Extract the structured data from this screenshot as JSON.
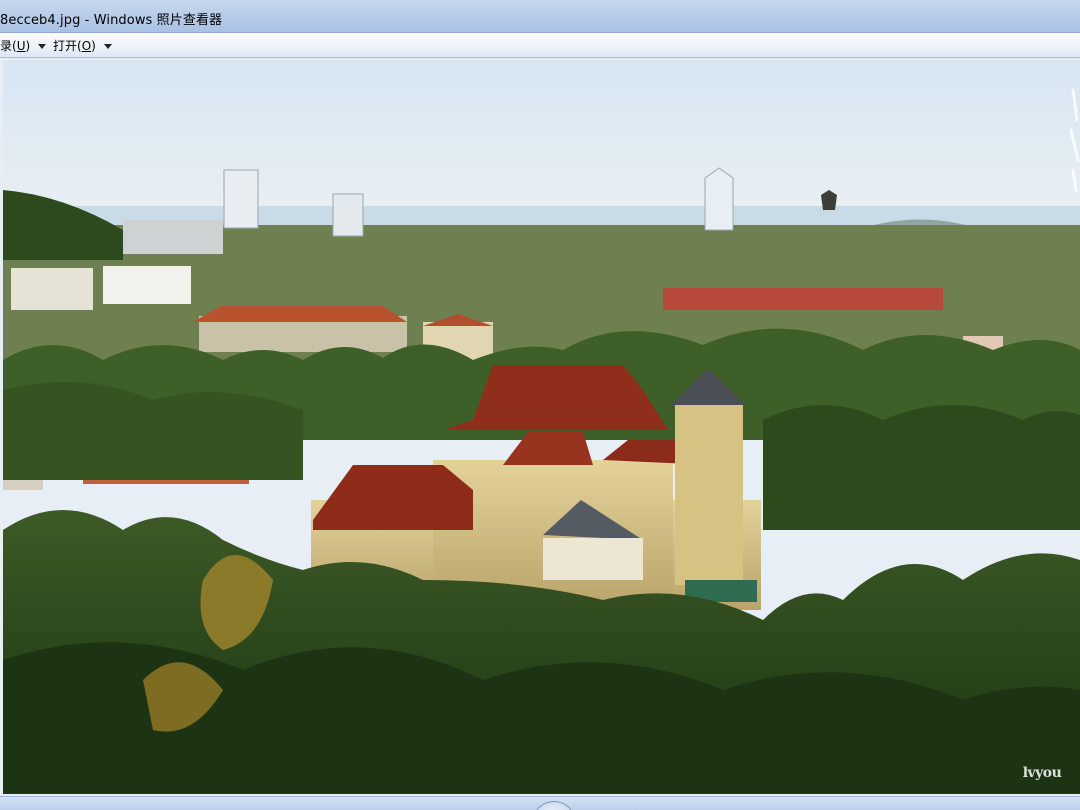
{
  "window": {
    "title": "8ecceb4.jpg - Windows 照片查看器"
  },
  "menu": {
    "items": [
      {
        "label": "录(U)",
        "pre": "录(",
        "acc": "U",
        "post": ")"
      },
      {
        "label": "打开(O)",
        "pre": "打开(",
        "acc": "O",
        "post": ")"
      }
    ]
  },
  "photo": {
    "subject": "aerial-city-landscape",
    "watermark_text": "lvyou",
    "colors": {
      "sky_top": "#d8e7f3",
      "sky_bottom": "#e9eff2",
      "sea": "#c9dbe7",
      "forest_dark": "#1f3b17",
      "forest_mid": "#3c5a22",
      "roof_red": "#9c3a22",
      "wall_yellow": "#d9c48c"
    }
  },
  "controls": {
    "play_icon": "slideshow-play-icon"
  }
}
